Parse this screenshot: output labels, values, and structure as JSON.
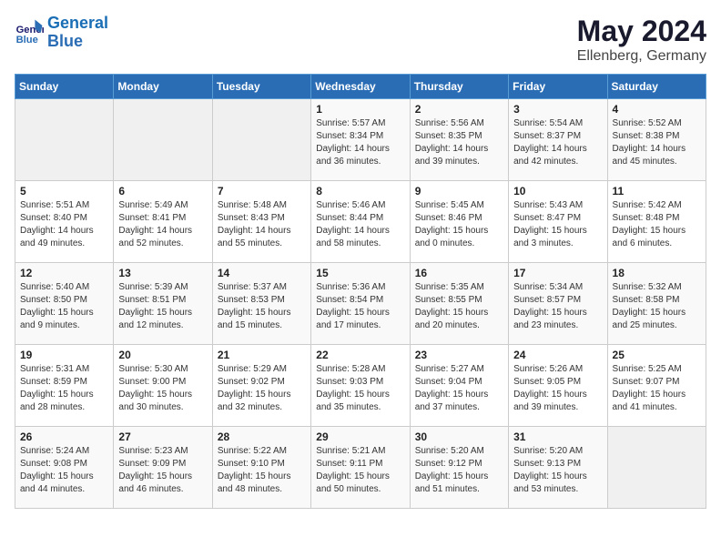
{
  "header": {
    "logo_line1": "General",
    "logo_line2": "Blue",
    "month_year": "May 2024",
    "location": "Ellenberg, Germany"
  },
  "days_of_week": [
    "Sunday",
    "Monday",
    "Tuesday",
    "Wednesday",
    "Thursday",
    "Friday",
    "Saturday"
  ],
  "weeks": [
    [
      {
        "day": "",
        "info": ""
      },
      {
        "day": "",
        "info": ""
      },
      {
        "day": "",
        "info": ""
      },
      {
        "day": "1",
        "info": "Sunrise: 5:57 AM\nSunset: 8:34 PM\nDaylight: 14 hours\nand 36 minutes."
      },
      {
        "day": "2",
        "info": "Sunrise: 5:56 AM\nSunset: 8:35 PM\nDaylight: 14 hours\nand 39 minutes."
      },
      {
        "day": "3",
        "info": "Sunrise: 5:54 AM\nSunset: 8:37 PM\nDaylight: 14 hours\nand 42 minutes."
      },
      {
        "day": "4",
        "info": "Sunrise: 5:52 AM\nSunset: 8:38 PM\nDaylight: 14 hours\nand 45 minutes."
      }
    ],
    [
      {
        "day": "5",
        "info": "Sunrise: 5:51 AM\nSunset: 8:40 PM\nDaylight: 14 hours\nand 49 minutes."
      },
      {
        "day": "6",
        "info": "Sunrise: 5:49 AM\nSunset: 8:41 PM\nDaylight: 14 hours\nand 52 minutes."
      },
      {
        "day": "7",
        "info": "Sunrise: 5:48 AM\nSunset: 8:43 PM\nDaylight: 14 hours\nand 55 minutes."
      },
      {
        "day": "8",
        "info": "Sunrise: 5:46 AM\nSunset: 8:44 PM\nDaylight: 14 hours\nand 58 minutes."
      },
      {
        "day": "9",
        "info": "Sunrise: 5:45 AM\nSunset: 8:46 PM\nDaylight: 15 hours\nand 0 minutes."
      },
      {
        "day": "10",
        "info": "Sunrise: 5:43 AM\nSunset: 8:47 PM\nDaylight: 15 hours\nand 3 minutes."
      },
      {
        "day": "11",
        "info": "Sunrise: 5:42 AM\nSunset: 8:48 PM\nDaylight: 15 hours\nand 6 minutes."
      }
    ],
    [
      {
        "day": "12",
        "info": "Sunrise: 5:40 AM\nSunset: 8:50 PM\nDaylight: 15 hours\nand 9 minutes."
      },
      {
        "day": "13",
        "info": "Sunrise: 5:39 AM\nSunset: 8:51 PM\nDaylight: 15 hours\nand 12 minutes."
      },
      {
        "day": "14",
        "info": "Sunrise: 5:37 AM\nSunset: 8:53 PM\nDaylight: 15 hours\nand 15 minutes."
      },
      {
        "day": "15",
        "info": "Sunrise: 5:36 AM\nSunset: 8:54 PM\nDaylight: 15 hours\nand 17 minutes."
      },
      {
        "day": "16",
        "info": "Sunrise: 5:35 AM\nSunset: 8:55 PM\nDaylight: 15 hours\nand 20 minutes."
      },
      {
        "day": "17",
        "info": "Sunrise: 5:34 AM\nSunset: 8:57 PM\nDaylight: 15 hours\nand 23 minutes."
      },
      {
        "day": "18",
        "info": "Sunrise: 5:32 AM\nSunset: 8:58 PM\nDaylight: 15 hours\nand 25 minutes."
      }
    ],
    [
      {
        "day": "19",
        "info": "Sunrise: 5:31 AM\nSunset: 8:59 PM\nDaylight: 15 hours\nand 28 minutes."
      },
      {
        "day": "20",
        "info": "Sunrise: 5:30 AM\nSunset: 9:00 PM\nDaylight: 15 hours\nand 30 minutes."
      },
      {
        "day": "21",
        "info": "Sunrise: 5:29 AM\nSunset: 9:02 PM\nDaylight: 15 hours\nand 32 minutes."
      },
      {
        "day": "22",
        "info": "Sunrise: 5:28 AM\nSunset: 9:03 PM\nDaylight: 15 hours\nand 35 minutes."
      },
      {
        "day": "23",
        "info": "Sunrise: 5:27 AM\nSunset: 9:04 PM\nDaylight: 15 hours\nand 37 minutes."
      },
      {
        "day": "24",
        "info": "Sunrise: 5:26 AM\nSunset: 9:05 PM\nDaylight: 15 hours\nand 39 minutes."
      },
      {
        "day": "25",
        "info": "Sunrise: 5:25 AM\nSunset: 9:07 PM\nDaylight: 15 hours\nand 41 minutes."
      }
    ],
    [
      {
        "day": "26",
        "info": "Sunrise: 5:24 AM\nSunset: 9:08 PM\nDaylight: 15 hours\nand 44 minutes."
      },
      {
        "day": "27",
        "info": "Sunrise: 5:23 AM\nSunset: 9:09 PM\nDaylight: 15 hours\nand 46 minutes."
      },
      {
        "day": "28",
        "info": "Sunrise: 5:22 AM\nSunset: 9:10 PM\nDaylight: 15 hours\nand 48 minutes."
      },
      {
        "day": "29",
        "info": "Sunrise: 5:21 AM\nSunset: 9:11 PM\nDaylight: 15 hours\nand 50 minutes."
      },
      {
        "day": "30",
        "info": "Sunrise: 5:20 AM\nSunset: 9:12 PM\nDaylight: 15 hours\nand 51 minutes."
      },
      {
        "day": "31",
        "info": "Sunrise: 5:20 AM\nSunset: 9:13 PM\nDaylight: 15 hours\nand 53 minutes."
      },
      {
        "day": "",
        "info": ""
      }
    ]
  ]
}
